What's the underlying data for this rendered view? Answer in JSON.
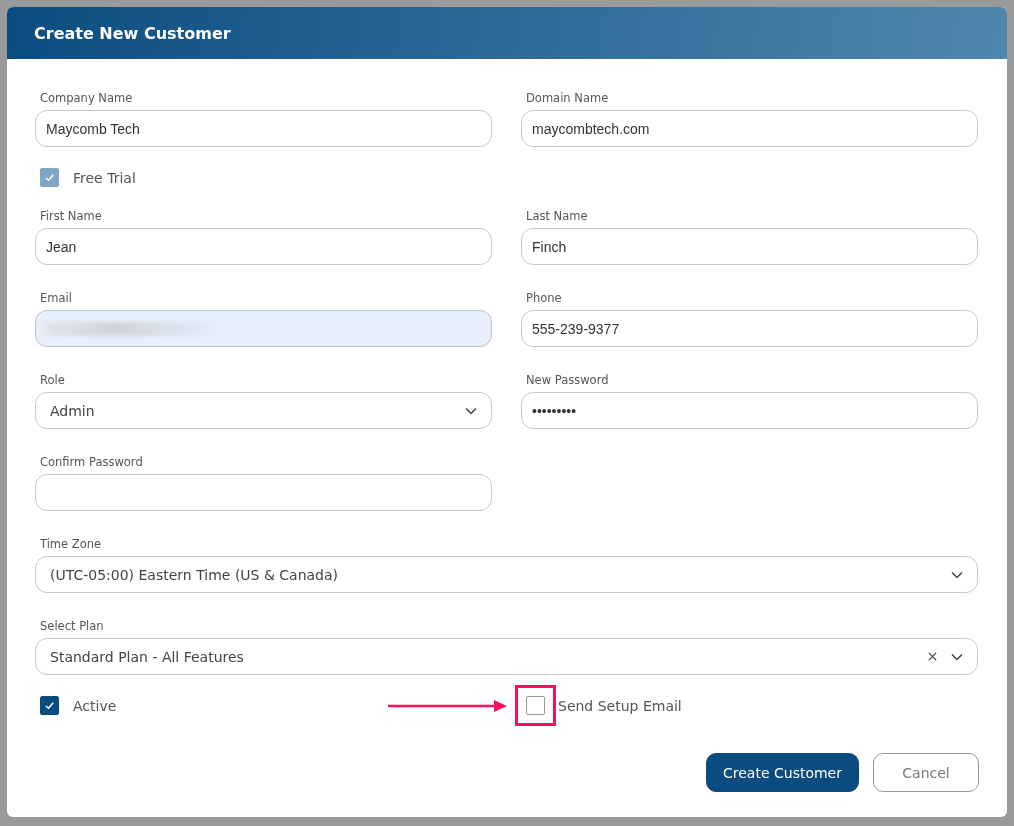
{
  "dialog": {
    "title": "Create New Customer"
  },
  "rows": [
    [
      {
        "kind": "text",
        "label": "Company Name",
        "value": "Maycomb Tech"
      },
      {
        "kind": "text",
        "label": "Domain Name",
        "value": "maycombtech.com"
      }
    ],
    [
      {
        "kind": "checkbox",
        "label": "Free Trial",
        "checked": true,
        "disabled": true
      }
    ],
    [
      {
        "kind": "text",
        "label": "First Name",
        "value": "Jean"
      },
      {
        "kind": "text",
        "label": "Last Name",
        "value": "Finch"
      }
    ],
    [
      {
        "kind": "redacted",
        "label": "Email"
      },
      {
        "kind": "text",
        "label": "Phone",
        "value": "555-239-9377"
      }
    ],
    [
      {
        "kind": "select",
        "label": "Role",
        "value": "Admin",
        "clearable": false
      },
      {
        "kind": "text",
        "label": "New Password",
        "value": "•••••••••"
      }
    ],
    [
      {
        "kind": "text",
        "label": "Confirm Password"
      }
    ],
    [
      {
        "kind": "select",
        "label": "Time Zone",
        "value": "(UTC-05:00) Eastern Time (US & Canada)",
        "clearable": false
      }
    ],
    [
      {
        "kind": "select",
        "label": "Select Plan",
        "value": "Standard Plan - All Features",
        "clearable": true
      }
    ],
    [
      {
        "kind": "checkbox",
        "label": "Active",
        "checked": true,
        "disabled": false
      },
      {
        "kind": "checkbox",
        "label": "Send Setup Email",
        "checked": false,
        "disabled": false,
        "highlighted": true
      }
    ]
  ],
  "buttons": [
    {
      "label": "Create Customer",
      "kind": "primary"
    },
    {
      "label": "Cancel",
      "kind": "secondary"
    }
  ]
}
